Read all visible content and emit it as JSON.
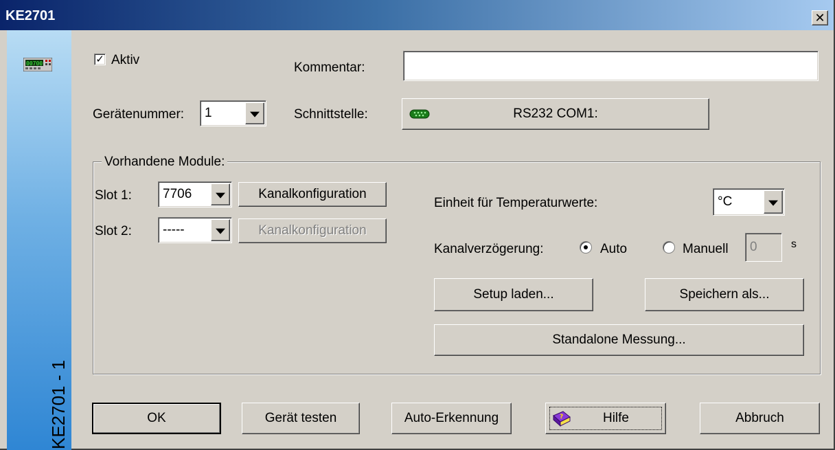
{
  "window": {
    "title": "KE2701",
    "close_symbol": "✕"
  },
  "sidebar": {
    "device_label": "KE2701 - 1",
    "icon": "multimeter-icon"
  },
  "form": {
    "aktiv_label": "Aktiv",
    "aktiv_checked": true,
    "aktiv_check_mark": "✓",
    "kommentar_label": "Kommentar:",
    "kommentar_value": "",
    "geraetenummer_label": "Gerätenummer:",
    "geraetenummer_value": "1",
    "schnittstelle_label": "Schnittstelle:",
    "schnittstelle_value": "RS232 COM1:"
  },
  "modules": {
    "group_title": "Vorhandene Module:",
    "slot1_label": "Slot 1:",
    "slot1_value": "7706",
    "slot1_button": "Kanalkonfiguration",
    "slot2_label": "Slot 2:",
    "slot2_value": "-----",
    "slot2_button": "Kanalkonfiguration",
    "temp_unit_label": "Einheit für Temperaturwerte:",
    "temp_unit_value": "°C",
    "delay_label": "Kanalverzögerung:",
    "delay_auto_label": "Auto",
    "delay_manual_label": "Manuell",
    "delay_selected": "Auto",
    "delay_value": "0",
    "delay_unit": "s",
    "setup_load_button": "Setup laden...",
    "save_as_button": "Speichern als...",
    "standalone_button": "Standalone Messung..."
  },
  "footer": {
    "ok_button": "OK",
    "test_button": "Gerät testen",
    "autodetect_button": "Auto-Erkennung",
    "help_button": "Hilfe",
    "help_icon": "help-book-icon",
    "cancel_button": "Abbruch"
  },
  "colors": {
    "face": "#d4d0c8",
    "title_start": "#0a246a",
    "title_end": "#a6caf0",
    "sidebar_top": "#b8dcf4",
    "sidebar_bottom": "#2f86d4"
  }
}
